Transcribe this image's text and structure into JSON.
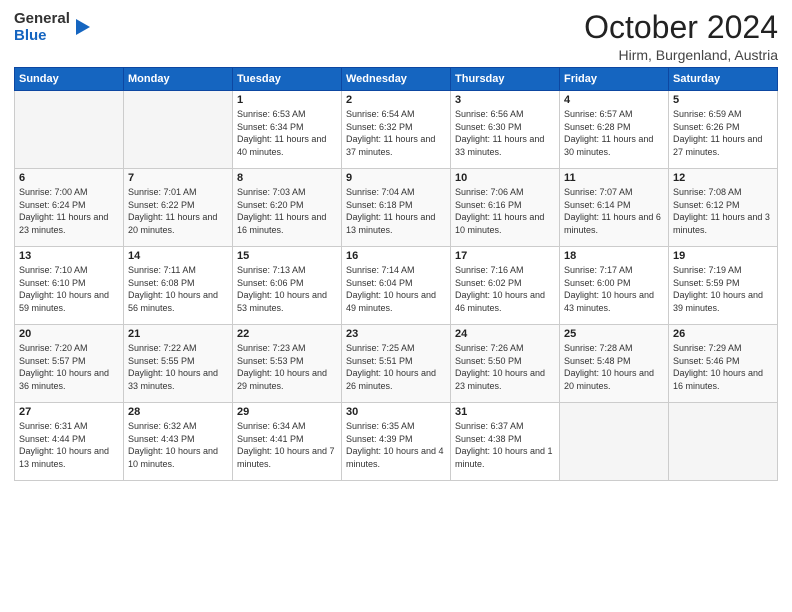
{
  "header": {
    "logo_general": "General",
    "logo_blue": "Blue",
    "month": "October 2024",
    "location": "Hirm, Burgenland, Austria"
  },
  "weekdays": [
    "Sunday",
    "Monday",
    "Tuesday",
    "Wednesday",
    "Thursday",
    "Friday",
    "Saturday"
  ],
  "weeks": [
    [
      {
        "day": "",
        "info": ""
      },
      {
        "day": "",
        "info": ""
      },
      {
        "day": "1",
        "info": "Sunrise: 6:53 AM\nSunset: 6:34 PM\nDaylight: 11 hours and 40 minutes."
      },
      {
        "day": "2",
        "info": "Sunrise: 6:54 AM\nSunset: 6:32 PM\nDaylight: 11 hours and 37 minutes."
      },
      {
        "day": "3",
        "info": "Sunrise: 6:56 AM\nSunset: 6:30 PM\nDaylight: 11 hours and 33 minutes."
      },
      {
        "day": "4",
        "info": "Sunrise: 6:57 AM\nSunset: 6:28 PM\nDaylight: 11 hours and 30 minutes."
      },
      {
        "day": "5",
        "info": "Sunrise: 6:59 AM\nSunset: 6:26 PM\nDaylight: 11 hours and 27 minutes."
      }
    ],
    [
      {
        "day": "6",
        "info": "Sunrise: 7:00 AM\nSunset: 6:24 PM\nDaylight: 11 hours and 23 minutes."
      },
      {
        "day": "7",
        "info": "Sunrise: 7:01 AM\nSunset: 6:22 PM\nDaylight: 11 hours and 20 minutes."
      },
      {
        "day": "8",
        "info": "Sunrise: 7:03 AM\nSunset: 6:20 PM\nDaylight: 11 hours and 16 minutes."
      },
      {
        "day": "9",
        "info": "Sunrise: 7:04 AM\nSunset: 6:18 PM\nDaylight: 11 hours and 13 minutes."
      },
      {
        "day": "10",
        "info": "Sunrise: 7:06 AM\nSunset: 6:16 PM\nDaylight: 11 hours and 10 minutes."
      },
      {
        "day": "11",
        "info": "Sunrise: 7:07 AM\nSunset: 6:14 PM\nDaylight: 11 hours and 6 minutes."
      },
      {
        "day": "12",
        "info": "Sunrise: 7:08 AM\nSunset: 6:12 PM\nDaylight: 11 hours and 3 minutes."
      }
    ],
    [
      {
        "day": "13",
        "info": "Sunrise: 7:10 AM\nSunset: 6:10 PM\nDaylight: 10 hours and 59 minutes."
      },
      {
        "day": "14",
        "info": "Sunrise: 7:11 AM\nSunset: 6:08 PM\nDaylight: 10 hours and 56 minutes."
      },
      {
        "day": "15",
        "info": "Sunrise: 7:13 AM\nSunset: 6:06 PM\nDaylight: 10 hours and 53 minutes."
      },
      {
        "day": "16",
        "info": "Sunrise: 7:14 AM\nSunset: 6:04 PM\nDaylight: 10 hours and 49 minutes."
      },
      {
        "day": "17",
        "info": "Sunrise: 7:16 AM\nSunset: 6:02 PM\nDaylight: 10 hours and 46 minutes."
      },
      {
        "day": "18",
        "info": "Sunrise: 7:17 AM\nSunset: 6:00 PM\nDaylight: 10 hours and 43 minutes."
      },
      {
        "day": "19",
        "info": "Sunrise: 7:19 AM\nSunset: 5:59 PM\nDaylight: 10 hours and 39 minutes."
      }
    ],
    [
      {
        "day": "20",
        "info": "Sunrise: 7:20 AM\nSunset: 5:57 PM\nDaylight: 10 hours and 36 minutes."
      },
      {
        "day": "21",
        "info": "Sunrise: 7:22 AM\nSunset: 5:55 PM\nDaylight: 10 hours and 33 minutes."
      },
      {
        "day": "22",
        "info": "Sunrise: 7:23 AM\nSunset: 5:53 PM\nDaylight: 10 hours and 29 minutes."
      },
      {
        "day": "23",
        "info": "Sunrise: 7:25 AM\nSunset: 5:51 PM\nDaylight: 10 hours and 26 minutes."
      },
      {
        "day": "24",
        "info": "Sunrise: 7:26 AM\nSunset: 5:50 PM\nDaylight: 10 hours and 23 minutes."
      },
      {
        "day": "25",
        "info": "Sunrise: 7:28 AM\nSunset: 5:48 PM\nDaylight: 10 hours and 20 minutes."
      },
      {
        "day": "26",
        "info": "Sunrise: 7:29 AM\nSunset: 5:46 PM\nDaylight: 10 hours and 16 minutes."
      }
    ],
    [
      {
        "day": "27",
        "info": "Sunrise: 6:31 AM\nSunset: 4:44 PM\nDaylight: 10 hours and 13 minutes."
      },
      {
        "day": "28",
        "info": "Sunrise: 6:32 AM\nSunset: 4:43 PM\nDaylight: 10 hours and 10 minutes."
      },
      {
        "day": "29",
        "info": "Sunrise: 6:34 AM\nSunset: 4:41 PM\nDaylight: 10 hours and 7 minutes."
      },
      {
        "day": "30",
        "info": "Sunrise: 6:35 AM\nSunset: 4:39 PM\nDaylight: 10 hours and 4 minutes."
      },
      {
        "day": "31",
        "info": "Sunrise: 6:37 AM\nSunset: 4:38 PM\nDaylight: 10 hours and 1 minute."
      },
      {
        "day": "",
        "info": ""
      },
      {
        "day": "",
        "info": ""
      }
    ]
  ]
}
